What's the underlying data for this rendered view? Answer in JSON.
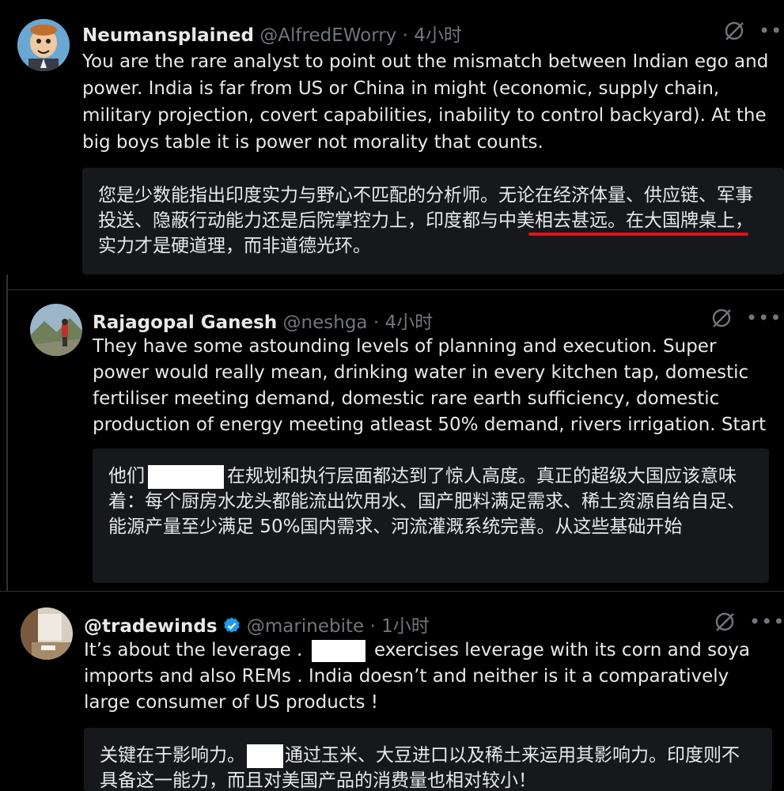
{
  "tweets": [
    {
      "name": "Neumansplained",
      "handle": "@AlfredEWorry",
      "time": "4小时",
      "text": "You are the rare analyst to point out the mismatch between Indian ego and power. India is far from US or China in might (economic, supply chain, military projection, covert capabilities, inability to control backyard). At the big boys table it is power not morality that counts.",
      "translation": "您是少数能指出印度实力与野心不匹配的分析师。无论在经济体量、供应链、军事投送、隐蔽行动能力还是后院掌控力上，印度都与中美相去甚远。在大国牌桌上，实力才是硬道理，而非道德光环。"
    },
    {
      "name": "Rajagopal Ganesh",
      "handle": "@neshga",
      "time": "4小时",
      "text": "They have some astounding levels of planning and execution.  Super power would really mean, drinking water in every kitchen tap, domestic fertiliser meeting demand, domestic rare earth sufficiency, domestic production of energy meeting atleast 50% demand, rivers irrigation. Start",
      "translation_a": "他们",
      "translation_b": "在规划和执行层面都达到了惊人高度。真正的超级大国应该意味着：每个厨房水龙头都能流出饮用水、国产肥料满足需求、稀土资源自给自足、能源产量至少满足 50%国内需求、河流灌溉系统完善。从这些基础开始"
    },
    {
      "name": "@tradewinds",
      "handle": "@marinebite",
      "time": "1小时",
      "text_a": "It’s about the leverage .",
      "text_b": "exercises leverage with its corn and soya imports and also REMs . India doesn’t and neither is it a comparatively large consumer of US products !",
      "translation_a": "关键在于影响力。",
      "translation_b": "通过玉米、大豆进口以及稀土来运用其影响力。印度则不具备这一能力，而且对美国产品的消费量也相对较小！"
    }
  ],
  "separator": " · ",
  "colors": {
    "background": "#000000",
    "text": "#e7e9ea",
    "muted": "#71767b",
    "verified": "#1d9bf0",
    "underline": "#e0121a"
  }
}
